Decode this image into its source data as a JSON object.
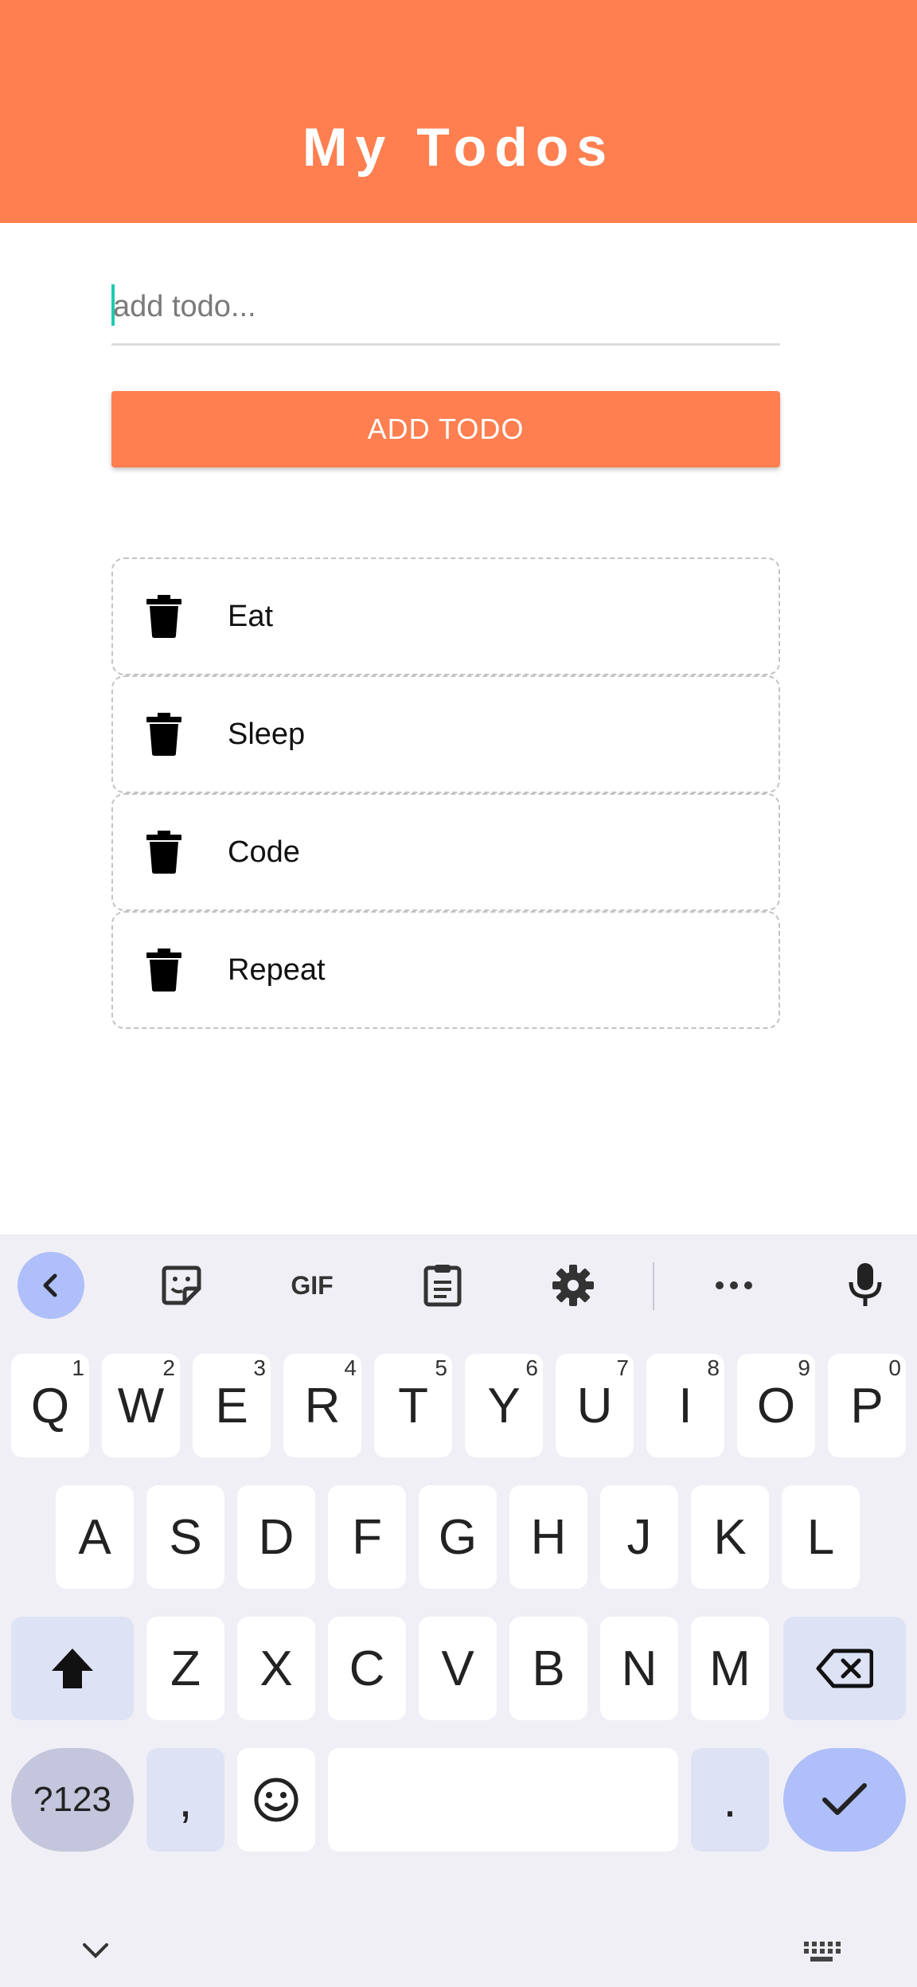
{
  "header": {
    "title": "My Todos",
    "bg_color": "#ff7f50"
  },
  "input": {
    "placeholder": "add todo...",
    "value": ""
  },
  "add_button": {
    "label": "ADD TODO"
  },
  "todos": [
    {
      "label": "Eat",
      "icon": "trash-icon"
    },
    {
      "label": "Sleep",
      "icon": "trash-icon"
    },
    {
      "label": "Code",
      "icon": "trash-icon"
    },
    {
      "label": "Repeat",
      "icon": "trash-icon"
    }
  ],
  "keyboard": {
    "toolbar": [
      "back-arrow-icon",
      "sticker-icon",
      "gif-icon",
      "clipboard-icon",
      "settings-icon",
      "more-icon",
      "microphone-icon"
    ],
    "gif_label": "GIF",
    "row1": [
      {
        "key": "Q",
        "hint": "1"
      },
      {
        "key": "W",
        "hint": "2"
      },
      {
        "key": "E",
        "hint": "3"
      },
      {
        "key": "R",
        "hint": "4"
      },
      {
        "key": "T",
        "hint": "5"
      },
      {
        "key": "Y",
        "hint": "6"
      },
      {
        "key": "U",
        "hint": "7"
      },
      {
        "key": "I",
        "hint": "8"
      },
      {
        "key": "O",
        "hint": "9"
      },
      {
        "key": "P",
        "hint": "0"
      }
    ],
    "row2": [
      "A",
      "S",
      "D",
      "F",
      "G",
      "H",
      "J",
      "K",
      "L"
    ],
    "row3": [
      "Z",
      "X",
      "C",
      "V",
      "B",
      "N",
      "M"
    ],
    "num_key": "?123",
    "comma": ",",
    "period": ".",
    "accent_color": "#aebff9"
  }
}
